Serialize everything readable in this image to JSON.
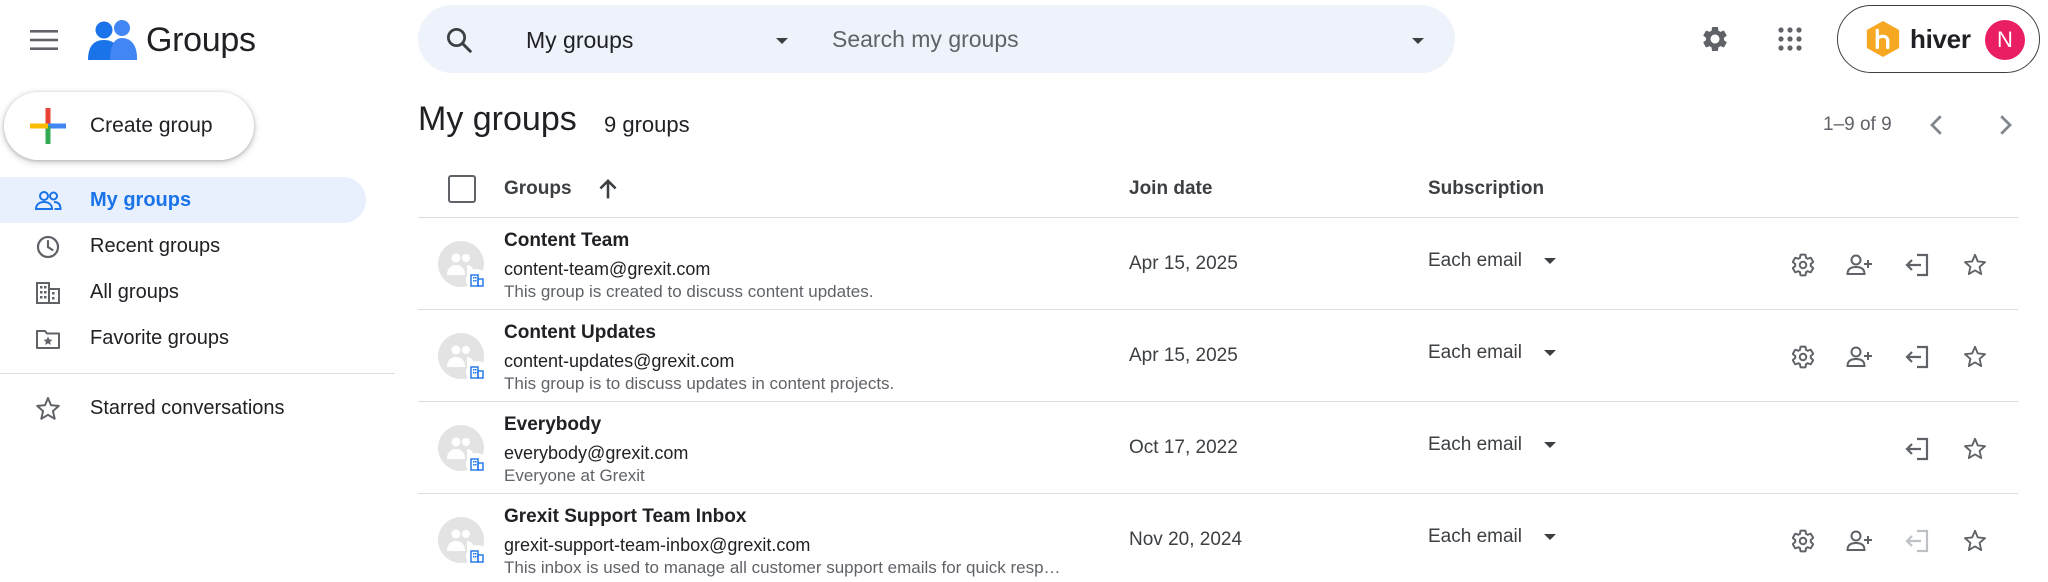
{
  "header": {
    "app_name": "Groups",
    "search_scope": "My groups",
    "search_placeholder": "Search my groups",
    "account_brand": "hiver",
    "avatar_initial": "N",
    "colors": {
      "search_bg": "#eef2fa",
      "avatar_bg": "#e91e63",
      "hiver_orange": "#f7a823",
      "accent": "#1a73e8"
    }
  },
  "sidebar": {
    "create_label": "Create group",
    "items": [
      {
        "label": "My groups",
        "icon": "people-icon",
        "active": true
      },
      {
        "label": "Recent groups",
        "icon": "clock-icon",
        "active": false
      },
      {
        "label": "All groups",
        "icon": "building-icon",
        "active": false
      },
      {
        "label": "Favorite groups",
        "icon": "folder-star-icon",
        "active": false
      }
    ],
    "starred_label": "Starred conversations"
  },
  "main": {
    "title": "My groups",
    "count": "9 groups",
    "pagination": "1–9 of 9",
    "columns": {
      "groups": "Groups",
      "join_date": "Join date",
      "subscription": "Subscription"
    },
    "rows": [
      {
        "name": "Content Team",
        "email": "content-team@grexit.com",
        "description": "This group is created to discuss content updates.",
        "join_date": "Apr 15, 2025",
        "subscription": "Each email",
        "can_manage": true,
        "leave_enabled": true
      },
      {
        "name": "Content Updates",
        "email": "content-updates@grexit.com",
        "description": "This group is to discuss updates in content projects.",
        "join_date": "Apr 15, 2025",
        "subscription": "Each email",
        "can_manage": true,
        "leave_enabled": true
      },
      {
        "name": "Everybody",
        "email": "everybody@grexit.com",
        "description": "Everyone at Grexit",
        "join_date": "Oct 17, 2022",
        "subscription": "Each email",
        "can_manage": false,
        "leave_enabled": true
      },
      {
        "name": "Grexit Support Team Inbox",
        "email": "grexit-support-team-inbox@grexit.com",
        "description": "This inbox is used to manage all customer support emails for quick resp…",
        "join_date": "Nov 20, 2024",
        "subscription": "Each email",
        "can_manage": true,
        "leave_enabled": false
      }
    ]
  }
}
